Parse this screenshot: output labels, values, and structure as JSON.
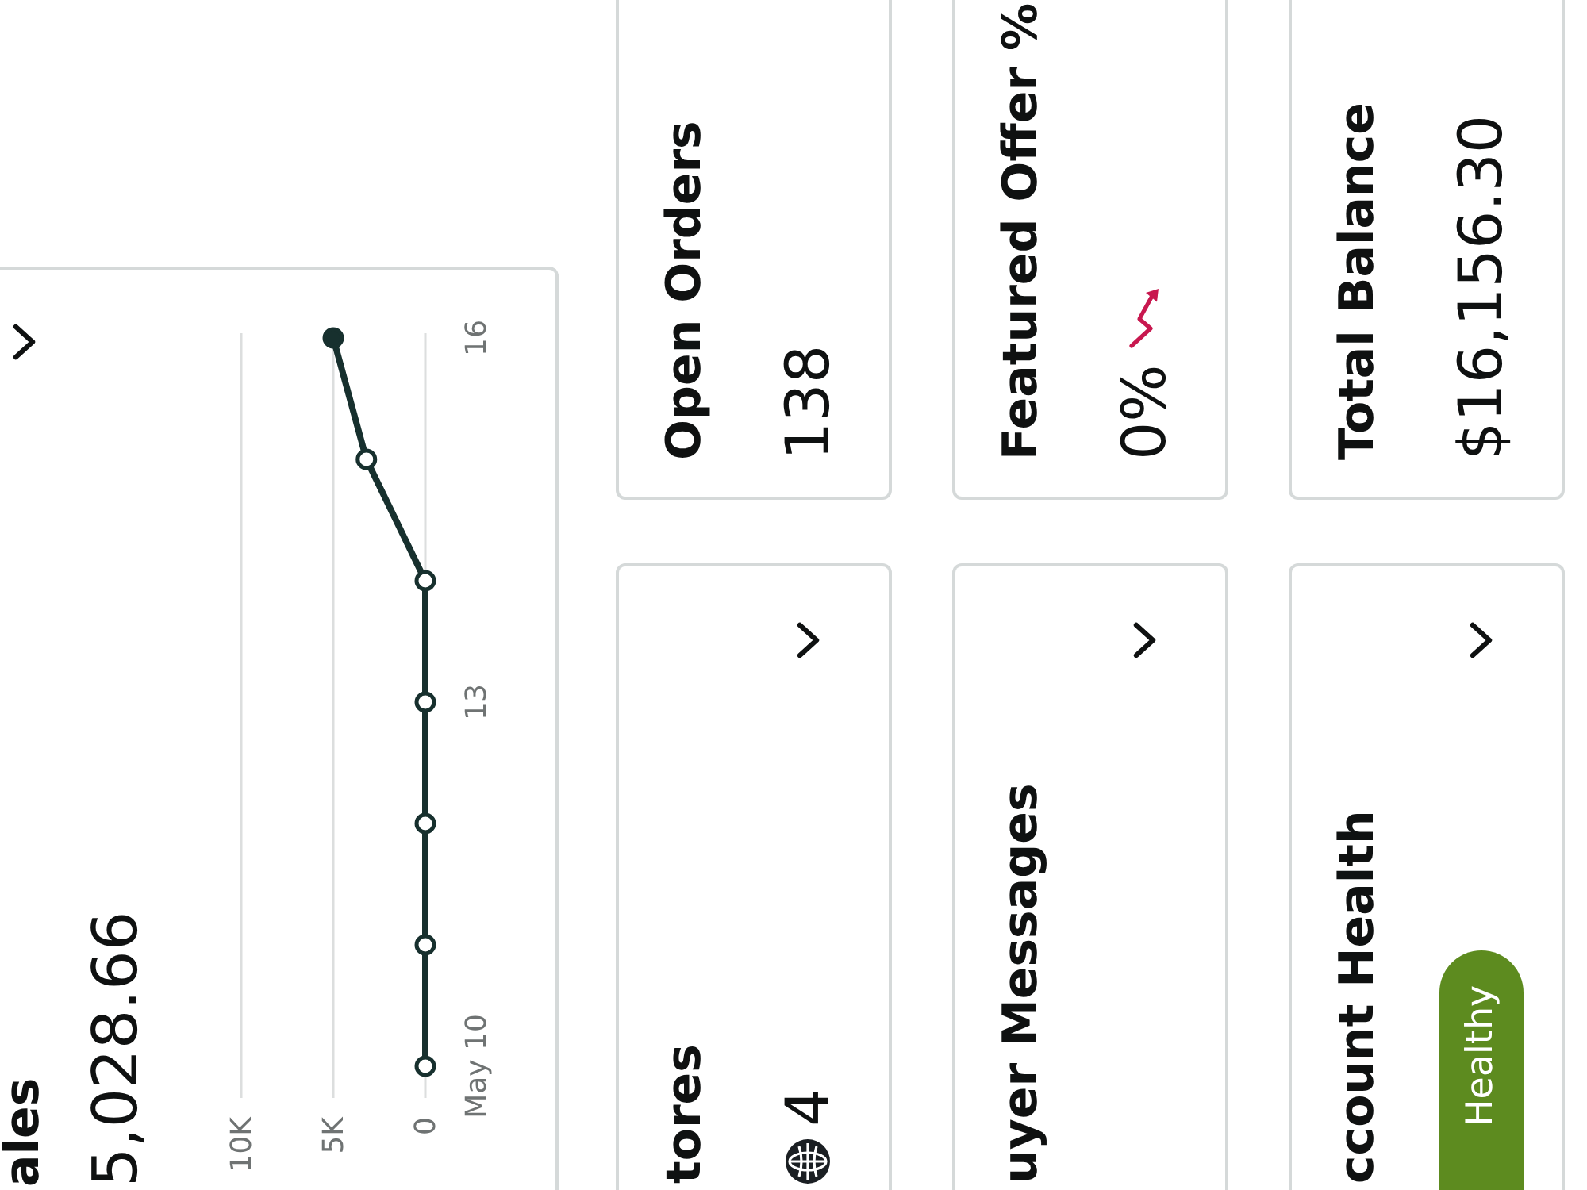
{
  "sales_card": {
    "title": "ales",
    "value": "5,028.66",
    "chart_data": {
      "type": "line",
      "orientation": "horizontal",
      "categories": [
        "16",
        null,
        null,
        "13",
        null,
        null,
        "May 10"
      ],
      "xlim": [
        10000,
        0
      ],
      "xticks": [
        {
          "value": 10000,
          "label": "10K"
        },
        {
          "value": 5000,
          "label": "5K"
        },
        {
          "value": 0,
          "label": "0"
        }
      ],
      "series": [
        {
          "color": "#17302e",
          "marker": "circle",
          "values": [
            5000,
            3200,
            0,
            0,
            0,
            0,
            0
          ]
        }
      ]
    }
  },
  "cards": [
    {
      "kind": "stores",
      "title": "tores",
      "value": "4"
    },
    {
      "kind": "metric",
      "title": "Open Orders",
      "value": "138"
    },
    {
      "kind": "link",
      "title": "uyer Messages"
    },
    {
      "kind": "trend",
      "title": "Featured Offer %",
      "value": "0%",
      "falling": true
    },
    {
      "kind": "status",
      "title": "ccount Health",
      "badge": "Healthy"
    },
    {
      "kind": "metric",
      "title": "Total Balance",
      "value": "$16,156.30"
    }
  ]
}
